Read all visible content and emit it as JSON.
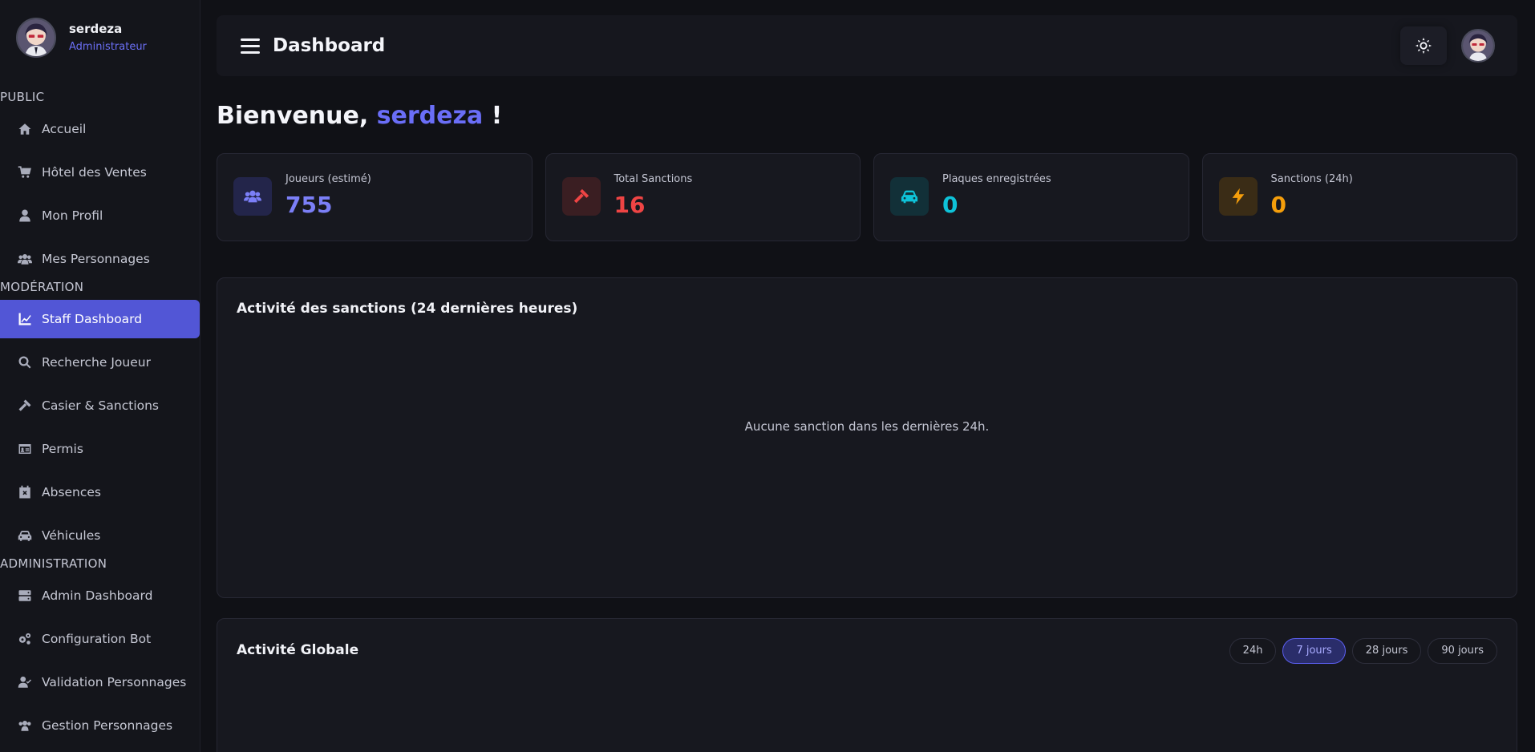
{
  "user": {
    "name": "serdeza",
    "role": "Administrateur"
  },
  "sidebar": {
    "sections": [
      {
        "label": "PUBLIC",
        "items": [
          {
            "label": "Accueil",
            "icon": "home-icon"
          },
          {
            "label": "Hôtel des Ventes",
            "icon": "cart-icon"
          },
          {
            "label": "Mon Profil",
            "icon": "user-icon"
          },
          {
            "label": "Mes Personnages",
            "icon": "users-icon"
          }
        ]
      },
      {
        "label": "MODÉRATION",
        "items": [
          {
            "label": "Staff Dashboard",
            "icon": "chart-line-icon",
            "active": true
          },
          {
            "label": "Recherche Joueur",
            "icon": "search-icon"
          },
          {
            "label": "Casier & Sanctions",
            "icon": "gavel-icon"
          },
          {
            "label": "Permis",
            "icon": "id-card-icon"
          },
          {
            "label": "Absences",
            "icon": "calendar-x-icon"
          },
          {
            "label": "Véhicules",
            "icon": "car-icon"
          }
        ]
      },
      {
        "label": "ADMINISTRATION",
        "items": [
          {
            "label": "Admin Dashboard",
            "icon": "server-icon"
          },
          {
            "label": "Configuration Bot",
            "icon": "gears-icon"
          },
          {
            "label": "Validation Personnages",
            "icon": "user-check-icon"
          },
          {
            "label": "Gestion Personnages",
            "icon": "users-icon"
          }
        ]
      }
    ]
  },
  "topbar": {
    "title": "Dashboard"
  },
  "welcome": {
    "prefix": "Bienvenue, ",
    "name": "serdeza",
    "suffix": " !"
  },
  "stats": [
    {
      "label": "Joueurs (estimé)",
      "value": "755",
      "color": "#7b7ff7",
      "bg": "#23254a",
      "icon": "users-icon"
    },
    {
      "label": "Total Sanctions",
      "value": "16",
      "color": "#ef4444",
      "bg": "#3a1e22",
      "icon": "gavel-icon"
    },
    {
      "label": "Plaques enregistrées",
      "value": "0",
      "color": "#0ec2d8",
      "bg": "#123038",
      "icon": "car-icon"
    },
    {
      "label": "Sanctions (24h)",
      "value": "0",
      "color": "#f59e0b",
      "bg": "#3a2c16",
      "icon": "bolt-icon"
    }
  ],
  "sanctions_panel": {
    "title": "Activité des sanctions (24 dernières heures)",
    "empty": "Aucune sanction dans les dernières 24h."
  },
  "global_panel": {
    "title": "Activité Globale",
    "ranges": [
      {
        "label": "24h",
        "active": false
      },
      {
        "label": "7 jours",
        "active": true
      },
      {
        "label": "28 jours",
        "active": false
      },
      {
        "label": "90 jours",
        "active": false
      }
    ]
  }
}
